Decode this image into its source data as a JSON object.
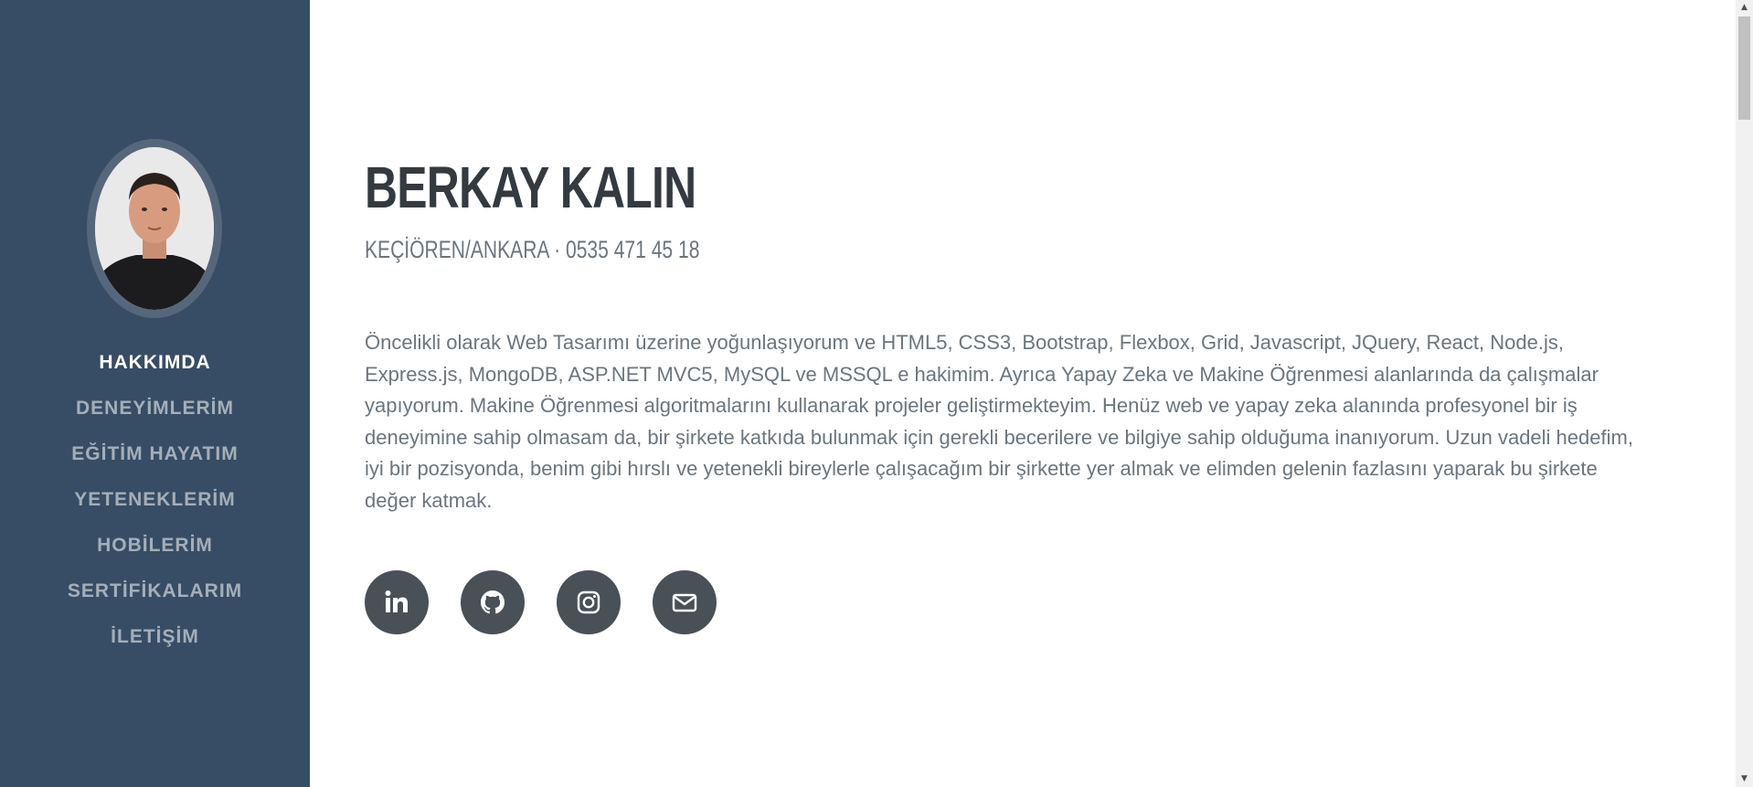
{
  "profile": {
    "photo_alt": "profile-photo"
  },
  "nav": {
    "items": [
      {
        "label": "HAKKIMDA",
        "active": true
      },
      {
        "label": "DENEYİMLERİM",
        "active": false
      },
      {
        "label": "EĞİTİM HAYATIM",
        "active": false
      },
      {
        "label": "YETENEKLERİM",
        "active": false
      },
      {
        "label": "HOBİLERİM",
        "active": false
      },
      {
        "label": "SERTİFİKALARIM",
        "active": false
      },
      {
        "label": "İLETİŞİM",
        "active": false
      }
    ]
  },
  "about": {
    "name": "BERKAY KALIN",
    "subheading": "KEÇİÖREN/ANKARA · 0535 471 45 18",
    "description": "Öncelikli olarak Web Tasarımı üzerine yoğunlaşıyorum ve HTML5, CSS3, Bootstrap, Flexbox, Grid, Javascript, JQuery, React, Node.js, Express.js, MongoDB, ASP.NET MVC5, MySQL ve MSSQL e hakimim. Ayrıca Yapay Zeka ve Makine Öğrenmesi alanlarında da çalışmalar yapıyorum. Makine Öğrenmesi algoritmalarını kullanarak projeler geliştirmekteyim. Henüz web ve yapay zeka alanında profesyonel bir iş deneyimine sahip olmasam da, bir şirkete katkıda bulunmak için gerekli becerilere ve bilgiye sahip olduğuma inanıyorum. Uzun vadeli hedefim, iyi bir pozisyonda, benim gibi hırslı ve yetenekli bireylerle çalışacağım bir şirkette yer almak ve elimden gelenin fazlasını yaparak bu şirkete değer katmak."
  },
  "social": {
    "icons": [
      "linkedin-icon",
      "github-icon",
      "instagram-icon",
      "envelope-icon"
    ]
  },
  "colors": {
    "sidebar": "#374d65",
    "heading": "#343a40",
    "text": "#6c757d",
    "social_bg": "#495057"
  }
}
